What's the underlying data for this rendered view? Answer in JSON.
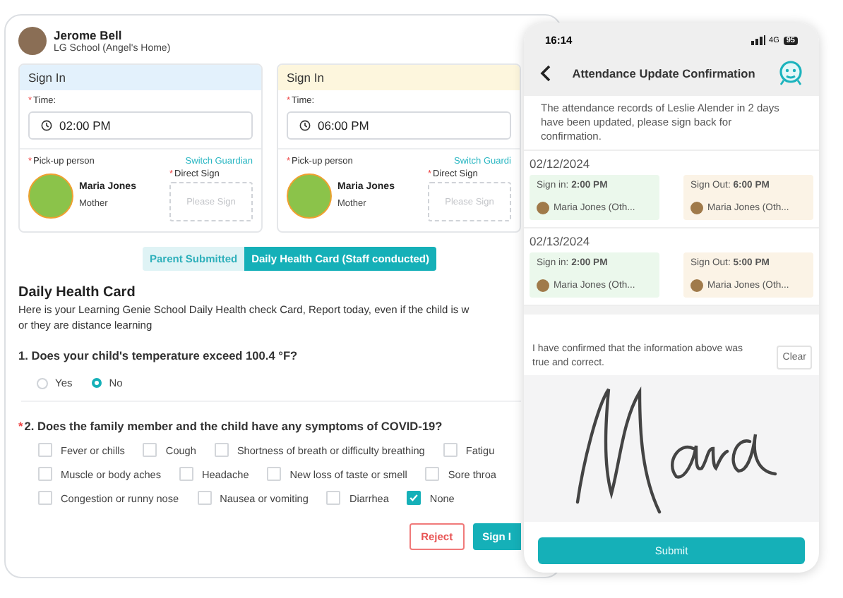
{
  "student": {
    "name": "Jerome Bell",
    "school": "LG School (Angel's Home)"
  },
  "sign_cards": [
    {
      "kind": "sign_in",
      "title": "Sign In",
      "time_mark": "*",
      "time_label": "Time:",
      "time": "02:00 PM",
      "pickup_mark": "*",
      "pickup_label": "Pick-up person",
      "switch_link": "Switch Guardian",
      "guardian_name": "Maria Jones",
      "guardian_relation": "Mother",
      "sign_mark": "*",
      "sign_label": "Direct Sign",
      "sign_placeholder": "Please Sign"
    },
    {
      "kind": "sign_out",
      "title": "Sign In",
      "time_mark": "*",
      "time_label": "Time:",
      "time": "06:00 PM",
      "pickup_mark": "*",
      "pickup_label": "Pick-up person",
      "switch_link": "Switch Guardi",
      "guardian_name": "Maria Jones",
      "guardian_relation": "Mother",
      "sign_mark": "*",
      "sign_label": "Direct Sign",
      "sign_placeholder": "Please Sign"
    }
  ],
  "tabs": [
    {
      "label": "Parent Submitted",
      "selected": false
    },
    {
      "label": "Daily Health Card (Staff conducted)",
      "selected": true
    }
  ],
  "health_card": {
    "title": "Daily Health Card",
    "description_lines": [
      "Here is your Learning Genie School Daily Health check Card, Report today, even if the child is w",
      "or they are distance learning"
    ],
    "question_1": {
      "text": "1. Does your child's temperature exceed 100.4 °F?",
      "options": [
        {
          "label": "Yes",
          "selected": false
        },
        {
          "label": "No",
          "selected": true
        }
      ]
    },
    "question_2": {
      "required_mark": "*",
      "text": "2. Does the family member and the child have any symptoms of COVID-19?",
      "rows": [
        [
          {
            "label": "Fever or chills",
            "checked": false
          },
          {
            "label": "Cough",
            "checked": false
          },
          {
            "label": "Shortness of breath or difficulty breathing",
            "checked": false
          },
          {
            "label": "Fatigu",
            "checked": false
          }
        ],
        [
          {
            "label": "Muscle or body aches",
            "checked": false
          },
          {
            "label": "Headache",
            "checked": false
          },
          {
            "label": "New loss of taste or smell",
            "checked": false
          },
          {
            "label": "Sore throa",
            "checked": false
          }
        ],
        [
          {
            "label": "Congestion or runny nose",
            "checked": false
          },
          {
            "label": "Nausea or vomiting",
            "checked": false
          },
          {
            "label": "Diarrhea",
            "checked": false
          },
          {
            "label": "None",
            "checked": true
          }
        ]
      ]
    },
    "buttons": [
      {
        "kind": "reject",
        "label": "Reject"
      },
      {
        "kind": "primary",
        "label": "Sign I"
      }
    ]
  },
  "phone": {
    "time": "16:14",
    "network": "4G",
    "battery": "95",
    "title": "Attendance Update Confirmation",
    "message": "The attendance records of Leslie Alender in 2 days have been updated, please sign back for confirmation.",
    "days": [
      {
        "date": "02/12/2024",
        "entries": [
          {
            "kind": "sign_in",
            "label": "Sign in: **2:00 PM**",
            "person": "Maria Jones (Oth..."
          },
          {
            "kind": "sign_out",
            "label": "Sign Out: **6:00 PM**",
            "person": "Maria Jones (Oth..."
          }
        ]
      },
      {
        "date": "02/13/2024",
        "entries": [
          {
            "kind": "sign_in",
            "label": "Sign in: **2:00 PM**",
            "person": "Maria Jones (Oth..."
          },
          {
            "kind": "sign_out",
            "label": "Sign Out: **5:00 PM**",
            "person": "Maria Jones (Oth..."
          }
        ]
      }
    ],
    "confirm_text": "I have confirmed that the information above was true and correct.",
    "clear_button": "Clear",
    "submit_button": "Submit"
  }
}
